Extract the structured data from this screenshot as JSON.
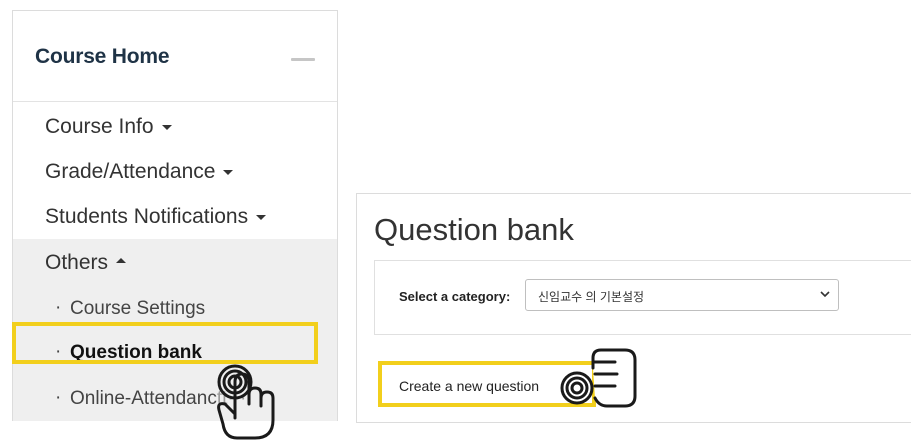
{
  "sidebar": {
    "title": "Course Home",
    "items": [
      {
        "label": "Course Info"
      },
      {
        "label": "Grade/Attendance"
      },
      {
        "label": "Students Notifications"
      },
      {
        "label": "Others"
      }
    ],
    "sub_items": [
      {
        "label": "Course Settings"
      },
      {
        "label": "Question bank"
      },
      {
        "label": "Online-Attendance Settings"
      }
    ],
    "truncated_third": "Online-Attendanc"
  },
  "question_bank": {
    "title": "Question bank",
    "category_label": "Select a category:",
    "category_value": "신임교수 의 기본설정",
    "create_button": "Create a new question"
  },
  "icons": [
    "collapse-icon",
    "caret-down-icon",
    "caret-up-icon",
    "pointing-hand-icon",
    "select-chevron-icon"
  ],
  "colors": {
    "highlight": "#f2cf1c",
    "active_group_bg": "#efefef",
    "title_color": "#1f3346"
  }
}
